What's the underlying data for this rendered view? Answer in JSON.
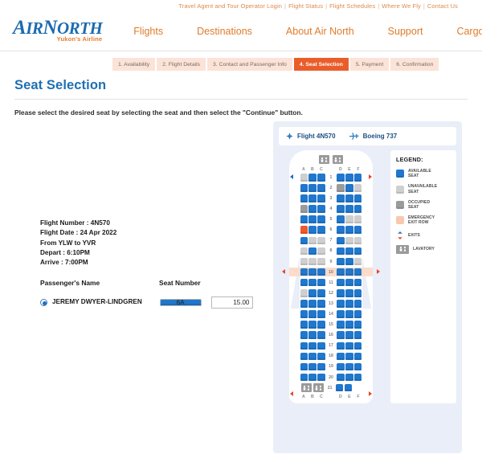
{
  "topbar": {
    "links": [
      "Travel Agent and Tour Operator Login",
      "Flight Status",
      "Flight Schedules",
      "Where We Fly",
      "Contact Us"
    ],
    "separator": "|"
  },
  "brand": {
    "line1_a": "A",
    "line1_b": "IR",
    "line1_c": "N",
    "line1_d": "ORTH",
    "tagline": "Yukon's Airline",
    "logo_color": "#1c6bb0",
    "tagline_color": "#e07b2a"
  },
  "nav": {
    "items": [
      "Flights",
      "Destinations",
      "About Air North",
      "Support",
      "Cargo"
    ],
    "color": "#e07b2a"
  },
  "steps": {
    "items": [
      "1. Availability",
      "2. Flight Details",
      "3. Contact and Passenger Info",
      "4. Seat Selection",
      "5. Payment",
      "6. Confirmation"
    ],
    "active_index": 3,
    "active_color": "#ea5d2b",
    "inactive_color": "#fbe3d8"
  },
  "page": {
    "title": "Seat Selection",
    "title_color": "#1f6fb2",
    "instruction": "Please select the desired seat by selecting the seat and then select the \"Continue\" button."
  },
  "flight_info": {
    "lines": [
      "Flight Number : 4N570",
      "Flight Date : 24 Apr 2022",
      "From YLW to YVR",
      "Depart : 6:10PM",
      "Arrive : 7:00PM"
    ],
    "flight_number": "4N570",
    "flight_date": "24 Apr 2022",
    "origin": "YLW",
    "destination": "YVR",
    "depart": "6:10PM",
    "arrive": "7:00PM"
  },
  "passenger_table": {
    "header_name": "Passenger's Name",
    "header_seat": "Seat Number",
    "rows": [
      {
        "name": "JEREMY  DWYER-LINDGREN",
        "seat": "6A",
        "price": "15.00",
        "selected": true
      }
    ]
  },
  "seatmap": {
    "flight_label": "Flight 4N570",
    "aircraft_label": "Boeing 737",
    "flight_icon": "propeller-icon",
    "aircraft_icon": "airplane-icon",
    "column_headers_left": [
      "A",
      "B",
      "C"
    ],
    "column_headers_right": [
      "D",
      "E",
      "F"
    ],
    "lavatory_icon": "lavatory-icon",
    "exit_row_numbers": [
      10
    ],
    "colors": {
      "available": "#2077cc",
      "unavailable": "#cfcfcf",
      "occupied": "#9b9b9b",
      "selected": "#f0592a",
      "exit_row": "#fbdccb",
      "panel_bg": "#eaeef8"
    },
    "rows": [
      {
        "number": "1",
        "left": [
          "unavailable",
          "available",
          "available"
        ],
        "right": [
          "available",
          "available",
          "available"
        ]
      },
      {
        "number": "2",
        "left": [
          "available",
          "available",
          "available"
        ],
        "right": [
          "occupied",
          "available",
          "unavailable"
        ]
      },
      {
        "number": "3",
        "left": [
          "available",
          "available",
          "available"
        ],
        "right": [
          "available",
          "available",
          "available"
        ]
      },
      {
        "number": "4",
        "left": [
          "occupied",
          "available",
          "available"
        ],
        "right": [
          "available",
          "available",
          "available"
        ]
      },
      {
        "number": "5",
        "left": [
          "available",
          "available",
          "available"
        ],
        "right": [
          "available",
          "unavailable",
          "unavailable"
        ]
      },
      {
        "number": "6",
        "left": [
          "selected",
          "available",
          "available"
        ],
        "right": [
          "available",
          "available",
          "available"
        ]
      },
      {
        "number": "7",
        "left": [
          "available",
          "unavailable",
          "unavailable"
        ],
        "right": [
          "available",
          "unavailable",
          "unavailable"
        ]
      },
      {
        "number": "8",
        "left": [
          "unavailable",
          "available",
          "unavailable"
        ],
        "right": [
          "available",
          "available",
          "available"
        ]
      },
      {
        "number": "9",
        "left": [
          "unavailable",
          "unavailable",
          "unavailable"
        ],
        "right": [
          "available",
          "available",
          "unavailable"
        ]
      },
      {
        "number": "10",
        "left": [
          "available",
          "available",
          "available"
        ],
        "right": [
          "available",
          "available",
          "available"
        ],
        "exit": true
      },
      {
        "number": "11",
        "left": [
          "available",
          "available",
          "available"
        ],
        "right": [
          "available",
          "available",
          "available"
        ]
      },
      {
        "number": "12",
        "left": [
          "unavailable",
          "available",
          "available"
        ],
        "right": [
          "available",
          "available",
          "available"
        ]
      },
      {
        "number": "13",
        "left": [
          "available",
          "available",
          "available"
        ],
        "right": [
          "available",
          "available",
          "available"
        ]
      },
      {
        "number": "14",
        "left": [
          "available",
          "available",
          "available"
        ],
        "right": [
          "available",
          "available",
          "available"
        ]
      },
      {
        "number": "15",
        "left": [
          "available",
          "available",
          "available"
        ],
        "right": [
          "available",
          "available",
          "available"
        ]
      },
      {
        "number": "16",
        "left": [
          "available",
          "available",
          "available"
        ],
        "right": [
          "available",
          "available",
          "available"
        ]
      },
      {
        "number": "17",
        "left": [
          "available",
          "available",
          "available"
        ],
        "right": [
          "available",
          "available",
          "available"
        ]
      },
      {
        "number": "18",
        "left": [
          "available",
          "available",
          "available"
        ],
        "right": [
          "available",
          "available",
          "available"
        ]
      },
      {
        "number": "19",
        "left": [
          "available",
          "available",
          "available"
        ],
        "right": [
          "available",
          "available",
          "available"
        ]
      },
      {
        "number": "20",
        "left": [
          "available",
          "available",
          "available"
        ],
        "right": [
          "available",
          "available",
          "available"
        ]
      },
      {
        "number": "21",
        "left": [
          "lavatory",
          "lavatory"
        ],
        "right": [
          "available",
          "available",
          "blank"
        ]
      }
    ]
  },
  "legend": {
    "title": "LEGEND:",
    "items": [
      {
        "swatch": "avail",
        "line1": "AVAILABLE",
        "line2": "SEAT"
      },
      {
        "swatch": "unavail",
        "line1": "UNAVAILABLE",
        "line2": "SEAT"
      },
      {
        "swatch": "occ",
        "line1": "OCCUPIED",
        "line2": "SEAT"
      },
      {
        "swatch": "exitrow",
        "line1": "EMERGENCY",
        "line2": "EXIT ROW"
      },
      {
        "swatch": "exit",
        "line1": "EXITS",
        "line2": ""
      },
      {
        "swatch": "lav",
        "line1": "LAVATORY",
        "line2": ""
      }
    ]
  }
}
